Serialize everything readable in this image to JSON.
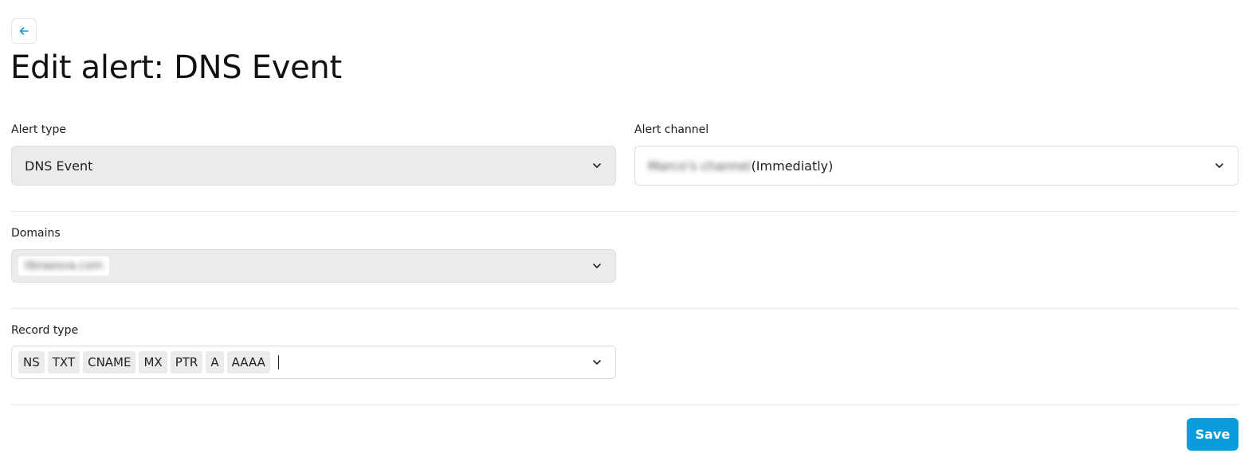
{
  "header": {
    "back_icon": "arrow-left-icon",
    "title": "Edit alert: DNS Event"
  },
  "alert_type": {
    "label": "Alert type",
    "value": "DNS Event"
  },
  "alert_channel": {
    "label": "Alert channel",
    "value_blurred": "Marco's channel",
    "value_suffix": "(Immediatly)"
  },
  "domains": {
    "label": "Domains",
    "value_blurred": "libraesva.com"
  },
  "record_type": {
    "label": "Record type",
    "tags": [
      "NS",
      "TXT",
      "CNAME",
      "MX",
      "PTR",
      "A",
      "AAAA"
    ]
  },
  "footer": {
    "save_label": "Save"
  },
  "colors": {
    "accent": "#0a9cdb",
    "disabled_bg": "#ebebeb"
  }
}
